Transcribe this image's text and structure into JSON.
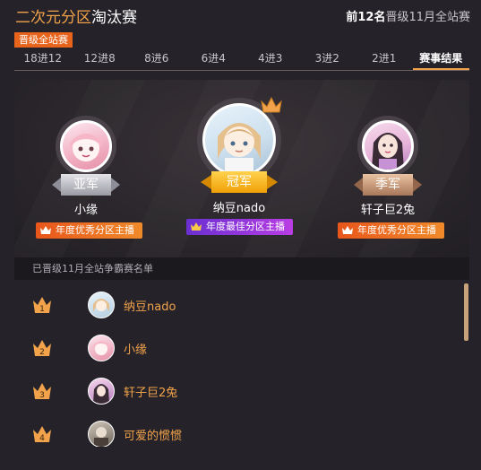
{
  "header": {
    "title_part1": "二次元分区",
    "title_part2": "淘汰赛",
    "right_bold": "前12名",
    "right_text": "晋级11月全站赛"
  },
  "badge": "晋级全站赛",
  "tabs": [
    "18进12",
    "12进8",
    "8进6",
    "6进4",
    "4进3",
    "3进2",
    "2进1",
    "赛事结果"
  ],
  "active_tab": "赛事结果",
  "podium": {
    "second": {
      "rank_label": "亚军",
      "name": "小缘",
      "award": "年度优秀分区主播"
    },
    "first": {
      "rank_label": "冠军",
      "name": "纳豆nado",
      "award": "年度最佳分区主播"
    },
    "third": {
      "rank_label": "季军",
      "name": "轩子巨2兔",
      "award": "年度优秀分区主播"
    }
  },
  "list_header": "已晋级11月全站争霸赛名单",
  "list": [
    {
      "rank": "1",
      "name": "纳豆nado"
    },
    {
      "rank": "2",
      "name": "小缘"
    },
    {
      "rank": "3",
      "name": "轩子巨2兔"
    },
    {
      "rank": "4",
      "name": "可爱的惯惯"
    }
  ],
  "colors": {
    "accent": "#f1a24a",
    "background": "#252329",
    "badge": "#e8641d"
  }
}
